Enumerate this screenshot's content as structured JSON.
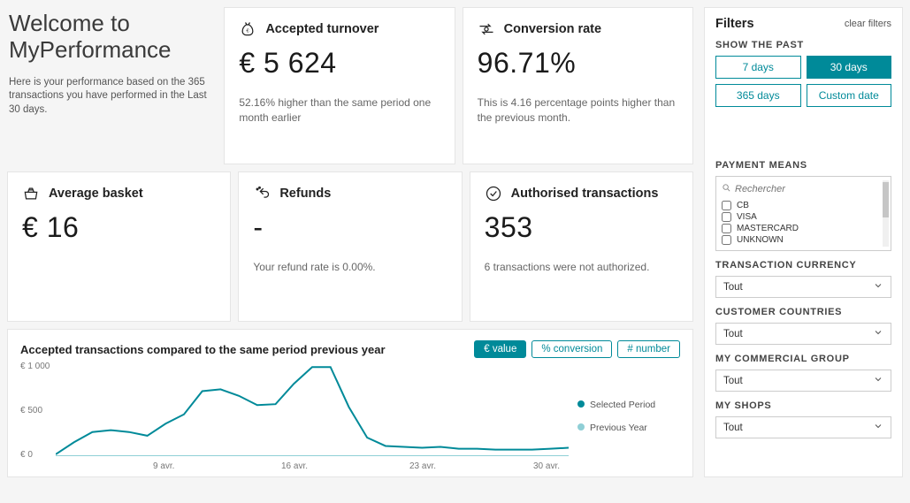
{
  "welcome": {
    "title_line1": "Welcome to",
    "title_line2": "MyPerformance",
    "subtitle": "Here is your performance based on the 365 transactions you have performed in the Last 30 days."
  },
  "kpis": {
    "accepted_turnover": {
      "title": "Accepted turnover",
      "value": "€ 5 624",
      "sub": "52.16% higher than the same period one month earlier"
    },
    "conversion_rate": {
      "title": "Conversion rate",
      "value": "96.71%",
      "sub": "This is 4.16 percentage points higher than the previous month."
    },
    "average_basket": {
      "title": "Average basket",
      "value": "€ 16",
      "sub": ""
    },
    "refunds": {
      "title": "Refunds",
      "value": "-",
      "sub": "Your refund rate is 0.00%."
    },
    "authorised": {
      "title": "Authorised transactions",
      "value": "353",
      "sub": "6 transactions were not authorized."
    }
  },
  "chart": {
    "title": "Accepted transactions compared to the same period previous year",
    "tabs": {
      "value": "€ value",
      "conversion": "% conversion",
      "number": "# number"
    },
    "legend": {
      "selected": "Selected Period",
      "previous": "Previous Year"
    }
  },
  "chart_data": {
    "type": "line",
    "title": "Accepted transactions compared to the same period previous year",
    "xlabel": "",
    "ylabel": "",
    "y_ticks": [
      "€ 0",
      "€ 500",
      "€ 1 000"
    ],
    "x_ticks": [
      "9 avr.",
      "16 avr.",
      "23 avr.",
      "30 avr."
    ],
    "ylim": [
      0,
      1000
    ],
    "x": [
      0,
      1,
      2,
      3,
      4,
      5,
      6,
      7,
      8,
      9,
      10,
      11,
      12,
      13,
      14,
      15,
      16,
      17,
      18,
      19,
      20,
      21,
      22,
      23,
      24,
      25,
      26,
      27,
      28
    ],
    "series": [
      {
        "name": "Selected Period",
        "color": "#008a99",
        "values": [
          20,
          150,
          260,
          280,
          260,
          220,
          350,
          450,
          700,
          720,
          650,
          550,
          560,
          780,
          960,
          960,
          530,
          200,
          110,
          100,
          90,
          100,
          80,
          80,
          70,
          70,
          70,
          80,
          90
        ]
      },
      {
        "name": "Previous Year",
        "color": "#8fcfd6",
        "values": [
          0,
          0,
          0,
          0,
          0,
          0,
          0,
          0,
          0,
          0,
          0,
          0,
          0,
          0,
          0,
          0,
          0,
          0,
          0,
          0,
          0,
          0,
          0,
          0,
          0,
          0,
          0,
          0,
          0
        ]
      }
    ]
  },
  "filters": {
    "title": "Filters",
    "clear": "clear filters",
    "show_past": {
      "title": "SHOW THE PAST",
      "d7": "7 days",
      "d30": "30 days",
      "d365": "365 days",
      "custom": "Custom date",
      "active": "30 days"
    },
    "payment_means": {
      "title": "PAYMENT MEANS",
      "search_placeholder": "Rechercher",
      "options": [
        "CB",
        "VISA",
        "MASTERCARD",
        "UNKNOWN"
      ]
    },
    "currency": {
      "title": "TRANSACTION CURRENCY",
      "value": "Tout"
    },
    "countries": {
      "title": "CUSTOMER COUNTRIES",
      "value": "Tout"
    },
    "commercial_group": {
      "title": "MY COMMERCIAL GROUP",
      "value": "Tout"
    },
    "shops": {
      "title": "MY SHOPS",
      "value": "Tout"
    }
  }
}
